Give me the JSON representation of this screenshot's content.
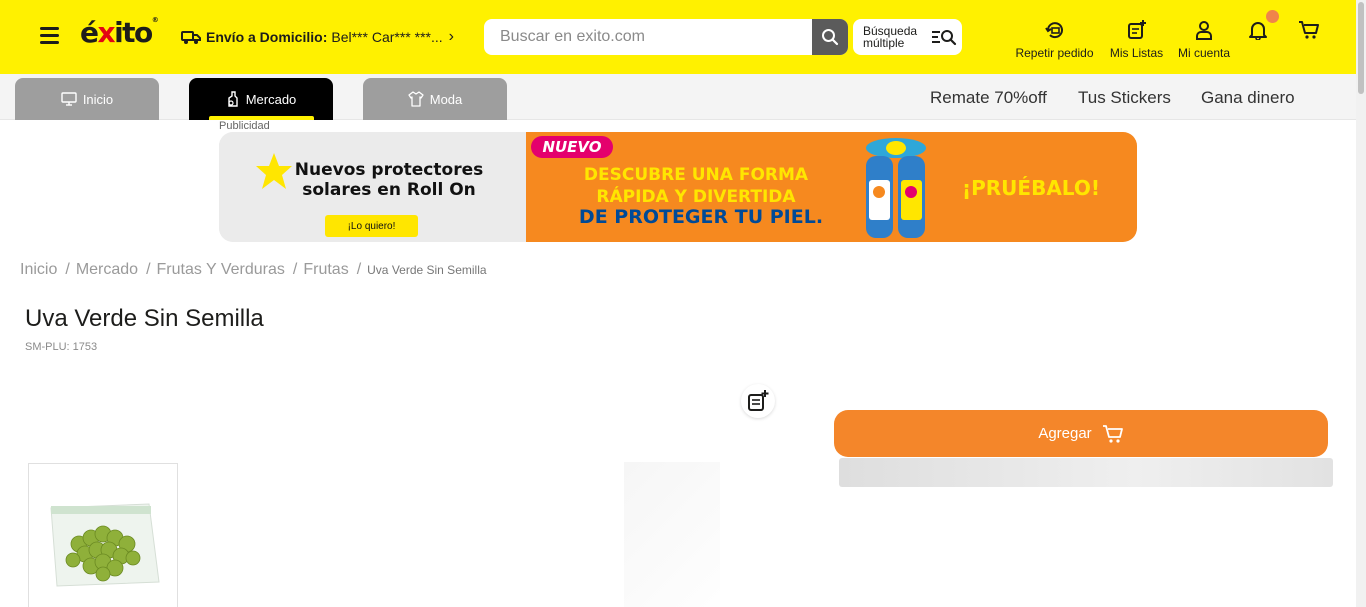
{
  "header": {
    "logo": {
      "prefix": "é",
      "accent": "x",
      "suffix": "ito",
      "reg": "®"
    },
    "delivery": {
      "label": "Envío a Domicilio:",
      "value": "Bel*** Car*** ***..."
    },
    "search": {
      "placeholder": "Buscar en exito.com",
      "value": ""
    },
    "multi_search": {
      "line1": "Búsqueda",
      "line2": "múltiple"
    },
    "icons": {
      "repeat_order": "Repetir pedido",
      "my_lists": "Mis Listas",
      "my_account": "Mi cuenta"
    }
  },
  "nav": {
    "tabs": [
      {
        "label": "Inicio",
        "icon": "monitor-icon",
        "active": false
      },
      {
        "label": "Mercado",
        "icon": "bottle-icon",
        "active": true
      },
      {
        "label": "Moda",
        "icon": "shirt-icon",
        "active": false
      }
    ],
    "links": [
      "Remate 70%off",
      "Tus Stickers",
      "Gana dinero"
    ]
  },
  "ad": {
    "label": "Publicidad",
    "left_headline": "Nuevos protectores solares en Roll On",
    "cta": "¡Lo quiero!",
    "badge": "NUEVO",
    "headline_1": "DESCUBRE UNA FORMA RÁPIDA Y DIVERTIDA",
    "headline_2": "DE PROTEGER TU PIEL.",
    "pruebalo": "¡PRUÉBALO!",
    "close": "✕",
    "colors": {
      "orange": "#f6891f",
      "yellow": "#ffe600",
      "blue": "#004a97",
      "pink": "#e4006d"
    }
  },
  "breadcrumb": {
    "items": [
      "Inicio",
      "Mercado",
      "Frutas Y Verduras",
      "Frutas"
    ],
    "separator": "/",
    "current": "Uva Verde Sin Semilla"
  },
  "product": {
    "title": "Uva Verde Sin Semilla",
    "plu": "SM-PLU: 1753",
    "add_button": "Agregar"
  },
  "colors": {
    "header_yellow": "#fff100",
    "add_orange": "#f4862a",
    "notification_dot": "#f0844a"
  }
}
